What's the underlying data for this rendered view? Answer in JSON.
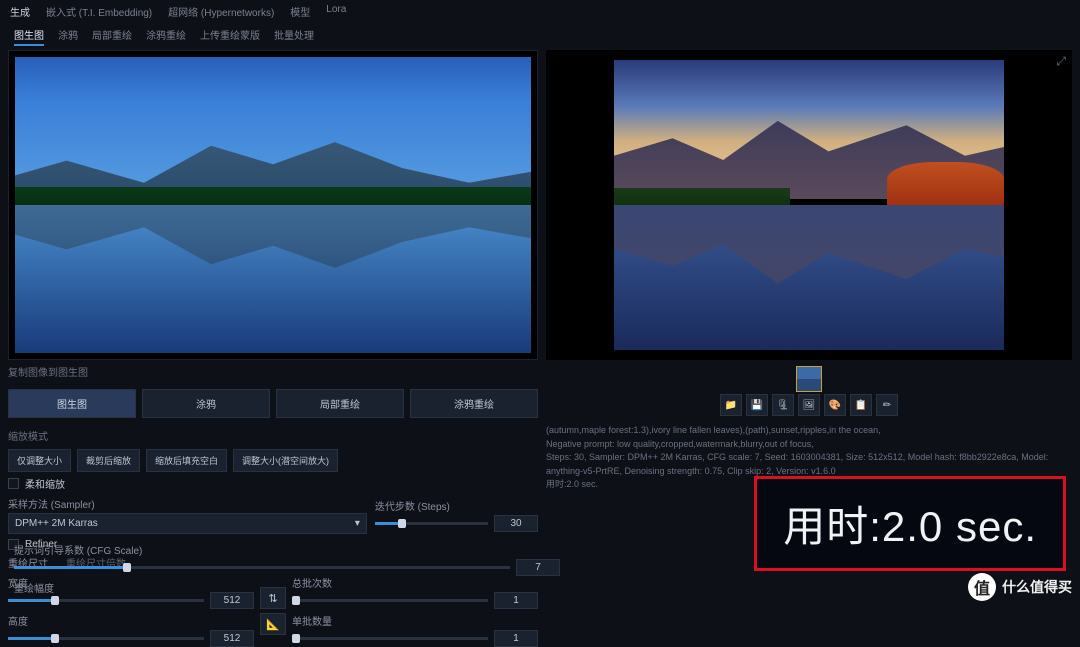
{
  "top_tabs": {
    "t0": "生成",
    "t1": "嵌入式 (T.I. Embedding)",
    "t2": "超网络 (Hypernetworks)",
    "t3": "模型",
    "t4": "Lora"
  },
  "sub_tabs": {
    "s0": "图生图",
    "s1": "涂鸦",
    "s2": "局部重绘",
    "s3": "涂鸦重绘",
    "s4": "上传重绘蒙版",
    "s5": "批量处理"
  },
  "caption": "复制图像到图生图",
  "btns": {
    "primary": "图生图",
    "b1": "涂鸦",
    "b2": "局部重绘",
    "b3": "涂鸦重绘"
  },
  "script_label": "缩放模式",
  "scripts": {
    "p0": "仅调整大小",
    "p1": "裁剪后缩放",
    "p2": "缩放后填充空白",
    "p3": "调整大小(潜空间放大)"
  },
  "check_resize": "柔和缩放",
  "sampler": {
    "label": "采样方法 (Sampler)",
    "value": "DPM++ 2M Karras"
  },
  "steps": {
    "label": "迭代步数 (Steps)",
    "value": "30"
  },
  "refiner": "Refiner",
  "resize": {
    "label": "重绘尺寸",
    "sub": "重绘尺寸倍数"
  },
  "width": {
    "label": "宽度",
    "value": "512"
  },
  "height": {
    "label": "高度",
    "value": "512"
  },
  "batch_count": {
    "label": "总批次数",
    "value": "1"
  },
  "batch_size": {
    "label": "单批数量",
    "value": "1"
  },
  "cfg": {
    "label": "提示词引导系数 (CFG Scale)",
    "value": "7"
  },
  "denoise": {
    "label": "重绘幅度",
    "value": "0.75"
  },
  "swap_icon": "⇅",
  "dim_icon": "📐",
  "thumb_name": "generated-thumbnail",
  "actions": {
    "a0": "📁",
    "a1": "💾",
    "a2": "🗜",
    "a3": "🖼",
    "a4": "🎨",
    "a5": "📋",
    "a6": "✏"
  },
  "meta": {
    "line1": "(autumn,maple forest:1.3),ivory line fallen leaves),(path),sunset,ripples,in the ocean,",
    "line2": "Negative prompt: low quality,cropped,watermark,blurry,out of focus,",
    "line3": "Steps: 30, Sampler: DPM++ 2M Karras, CFG scale: 7, Seed: 1603004381, Size: 512x512, Model hash: f8bb2922e8ca, Model: anything-v5-PrtRE, Denoising strength: 0.75, Clip skip: 2, Version: v1.6.0",
    "line4": "用时:2.0 sec."
  },
  "timer": "用时:2.0 sec.",
  "watermark": "什么值得买",
  "wm_char": "值",
  "expand_icon": "⤢"
}
